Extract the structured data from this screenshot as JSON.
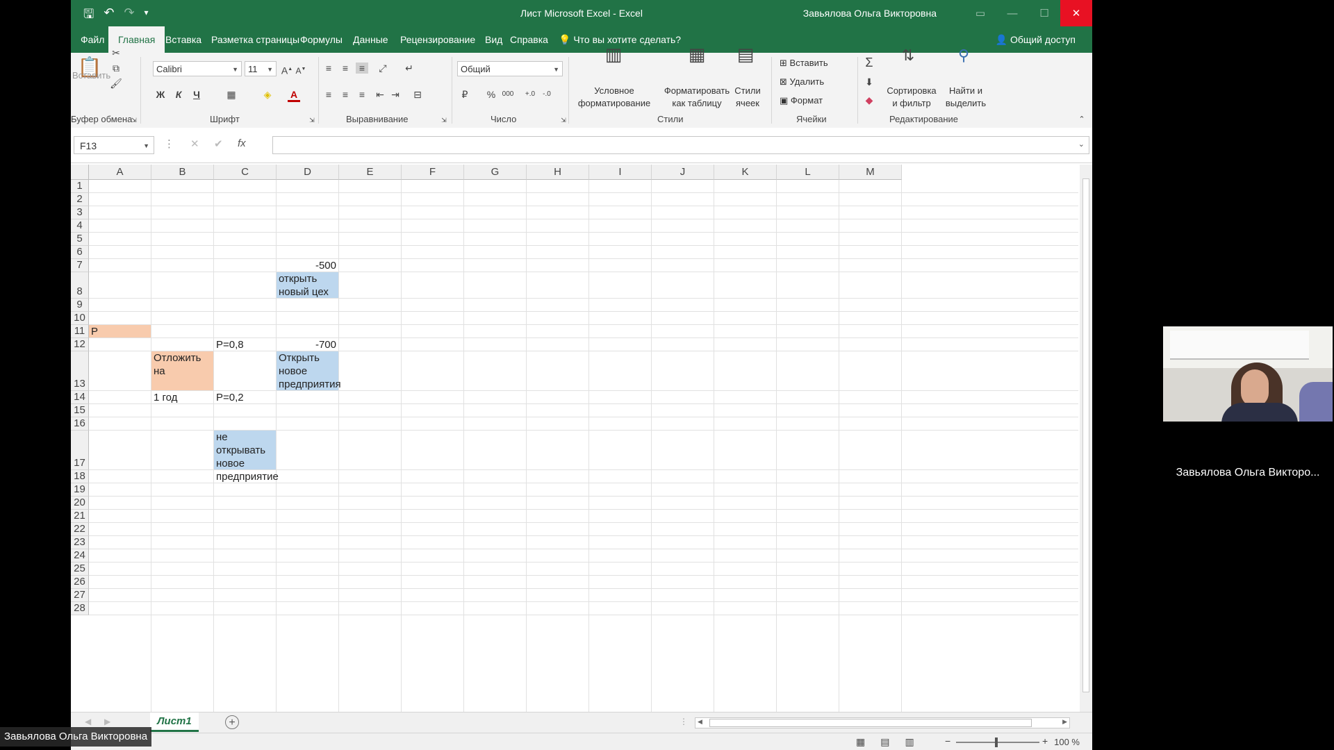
{
  "window": {
    "title": "Лист Microsoft Excel  -  Excel",
    "user": "Завьялова Ольга Викторовна"
  },
  "tabs": [
    "Файл",
    "Главная",
    "Вставка",
    "Разметка страницы",
    "Формулы",
    "Данные",
    "Рецензирование",
    "Вид",
    "Справка"
  ],
  "tell_me": "Что вы хотите сделать?",
  "share": "Общий доступ",
  "ribbon": {
    "paste_label": "Вставить",
    "font_name": "Calibri",
    "font_size": "11",
    "bold": "Ж",
    "italic": "К",
    "underline": "Ч",
    "number_format": "Общий",
    "cond_format_1": "Условное",
    "cond_format_2": "форматирование",
    "format_table_1": "Форматировать",
    "format_table_2": "как таблицу",
    "cell_styles_1": "Стили",
    "cell_styles_2": "ячеек",
    "insert": "Вставить",
    "delete": "Удалить",
    "format": "Формат",
    "sort_1": "Сортировка",
    "sort_2": "и фильтр",
    "find_1": "Найти и",
    "find_2": "выделить",
    "groups": {
      "clipboard": "Буфер обмена",
      "font": "Шрифт",
      "alignment": "Выравнивание",
      "number": "Число",
      "styles": "Стили",
      "cells": "Ячейки",
      "editing": "Редактирование"
    }
  },
  "formula_bar": {
    "name_box": "F13",
    "fx": "fx",
    "value": ""
  },
  "columns": [
    "A",
    "B",
    "C",
    "D",
    "E",
    "F",
    "G",
    "H",
    "I",
    "J",
    "K",
    "L",
    "M"
  ],
  "rows": [
    "1",
    "2",
    "3",
    "4",
    "5",
    "6",
    "7",
    "8",
    "9",
    "10",
    "11",
    "12",
    "13",
    "14",
    "15",
    "16",
    "17",
    "18",
    "19",
    "20",
    "21",
    "22",
    "23",
    "24",
    "25",
    "26",
    "27",
    "28"
  ],
  "cells": {
    "D7": "-500",
    "D8": "открыть\nновый цех",
    "A11": "P",
    "C12": "P=0,8",
    "D12": "-700",
    "B13": "Отложить на\n\n1 год",
    "D13": "Открыть\nновое\nпредприятия",
    "C14": "P=0,2",
    "C17": "не открывать\nновое\nпредприятие"
  },
  "colors": {
    "excel_green": "#217346",
    "orange_fill": "#f8cbad",
    "blue_fill": "#bdd7ee"
  },
  "sheet_tab": "Лист1",
  "status": {
    "zoom": "100 %"
  },
  "participant": {
    "name_bottom": "Завьялова Ольга Викторовна",
    "name_video": "Завьялова Ольга Викторо..."
  }
}
